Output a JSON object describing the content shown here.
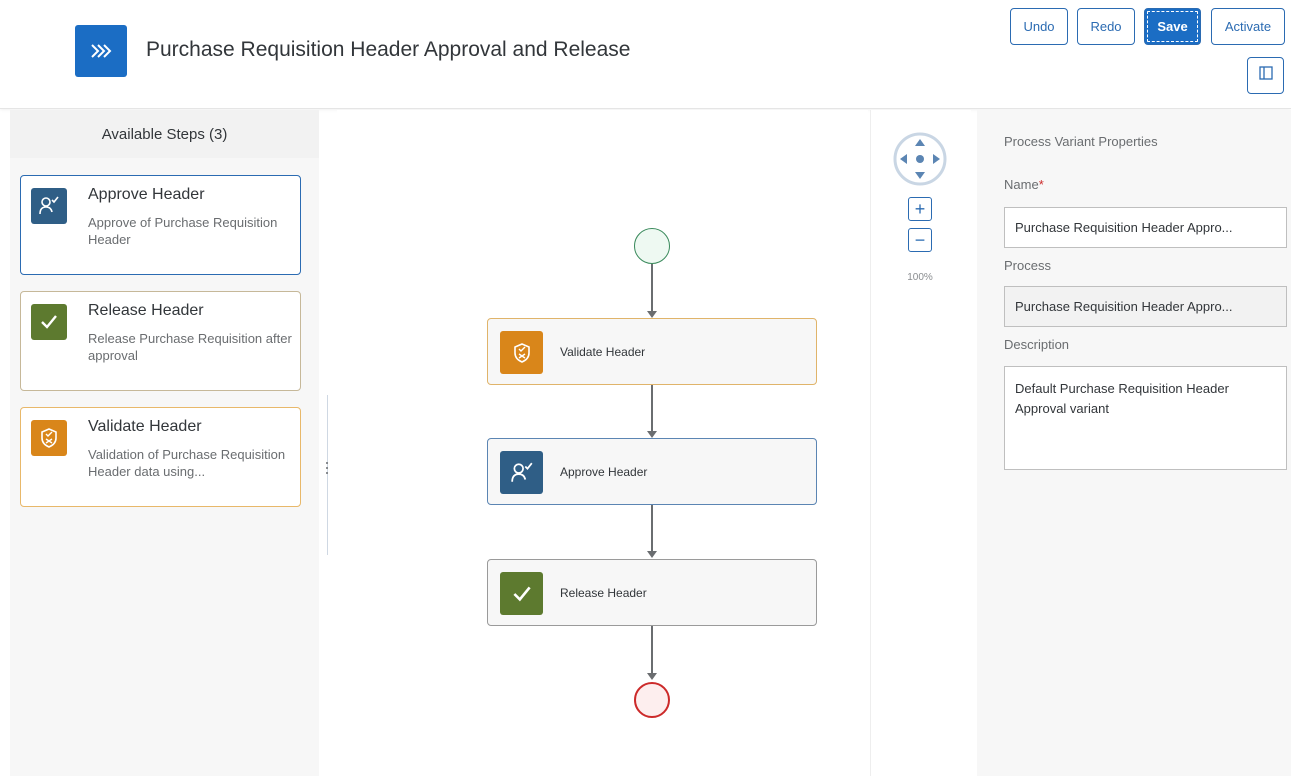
{
  "app": {
    "title": "Purchase Requisition Header Approval and Release",
    "icon": "chevrons-right-icon",
    "brand_color": "#1b6dc4"
  },
  "toolbar": {
    "undo_label": "Undo",
    "redo_label": "Redo",
    "save_label": "Save",
    "activate_label": "Activate",
    "panel_toggle_icon": "side-panel-icon"
  },
  "left_panel": {
    "title": "Available Steps (3)",
    "steps": [
      {
        "title": "Approve Header",
        "description": "Approve of Purchase Requisition Header",
        "icon": "user-approve-icon",
        "color": "#2f5e86"
      },
      {
        "title": "Release Header",
        "description": "Release Purchase Requisition after approval",
        "icon": "checkmark-icon",
        "color": "#5d7a2f"
      },
      {
        "title": "Validate Header",
        "description": "Validation of Purchase Requisition Header data using...",
        "icon": "shield-validate-icon",
        "color": "#d9861a"
      }
    ]
  },
  "canvas": {
    "nodes": [
      {
        "label": "Validate Header",
        "icon": "shield-validate-icon",
        "color": "#d9861a"
      },
      {
        "label": "Approve Header",
        "icon": "user-approve-icon",
        "color": "#2f5e86"
      },
      {
        "label": "Release Header",
        "icon": "checkmark-icon",
        "color": "#5d7a2f"
      }
    ],
    "zoom_level": "100%"
  },
  "properties": {
    "title": "Process Variant Properties",
    "name_label": "Name",
    "name_required_mark": "*",
    "name_value": "Purchase Requisition Header Appro...",
    "process_label": "Process",
    "process_value": "Purchase Requisition Header Appro...",
    "description_label": "Description",
    "description_value": "Default Purchase Requisition Header Approval variant"
  }
}
